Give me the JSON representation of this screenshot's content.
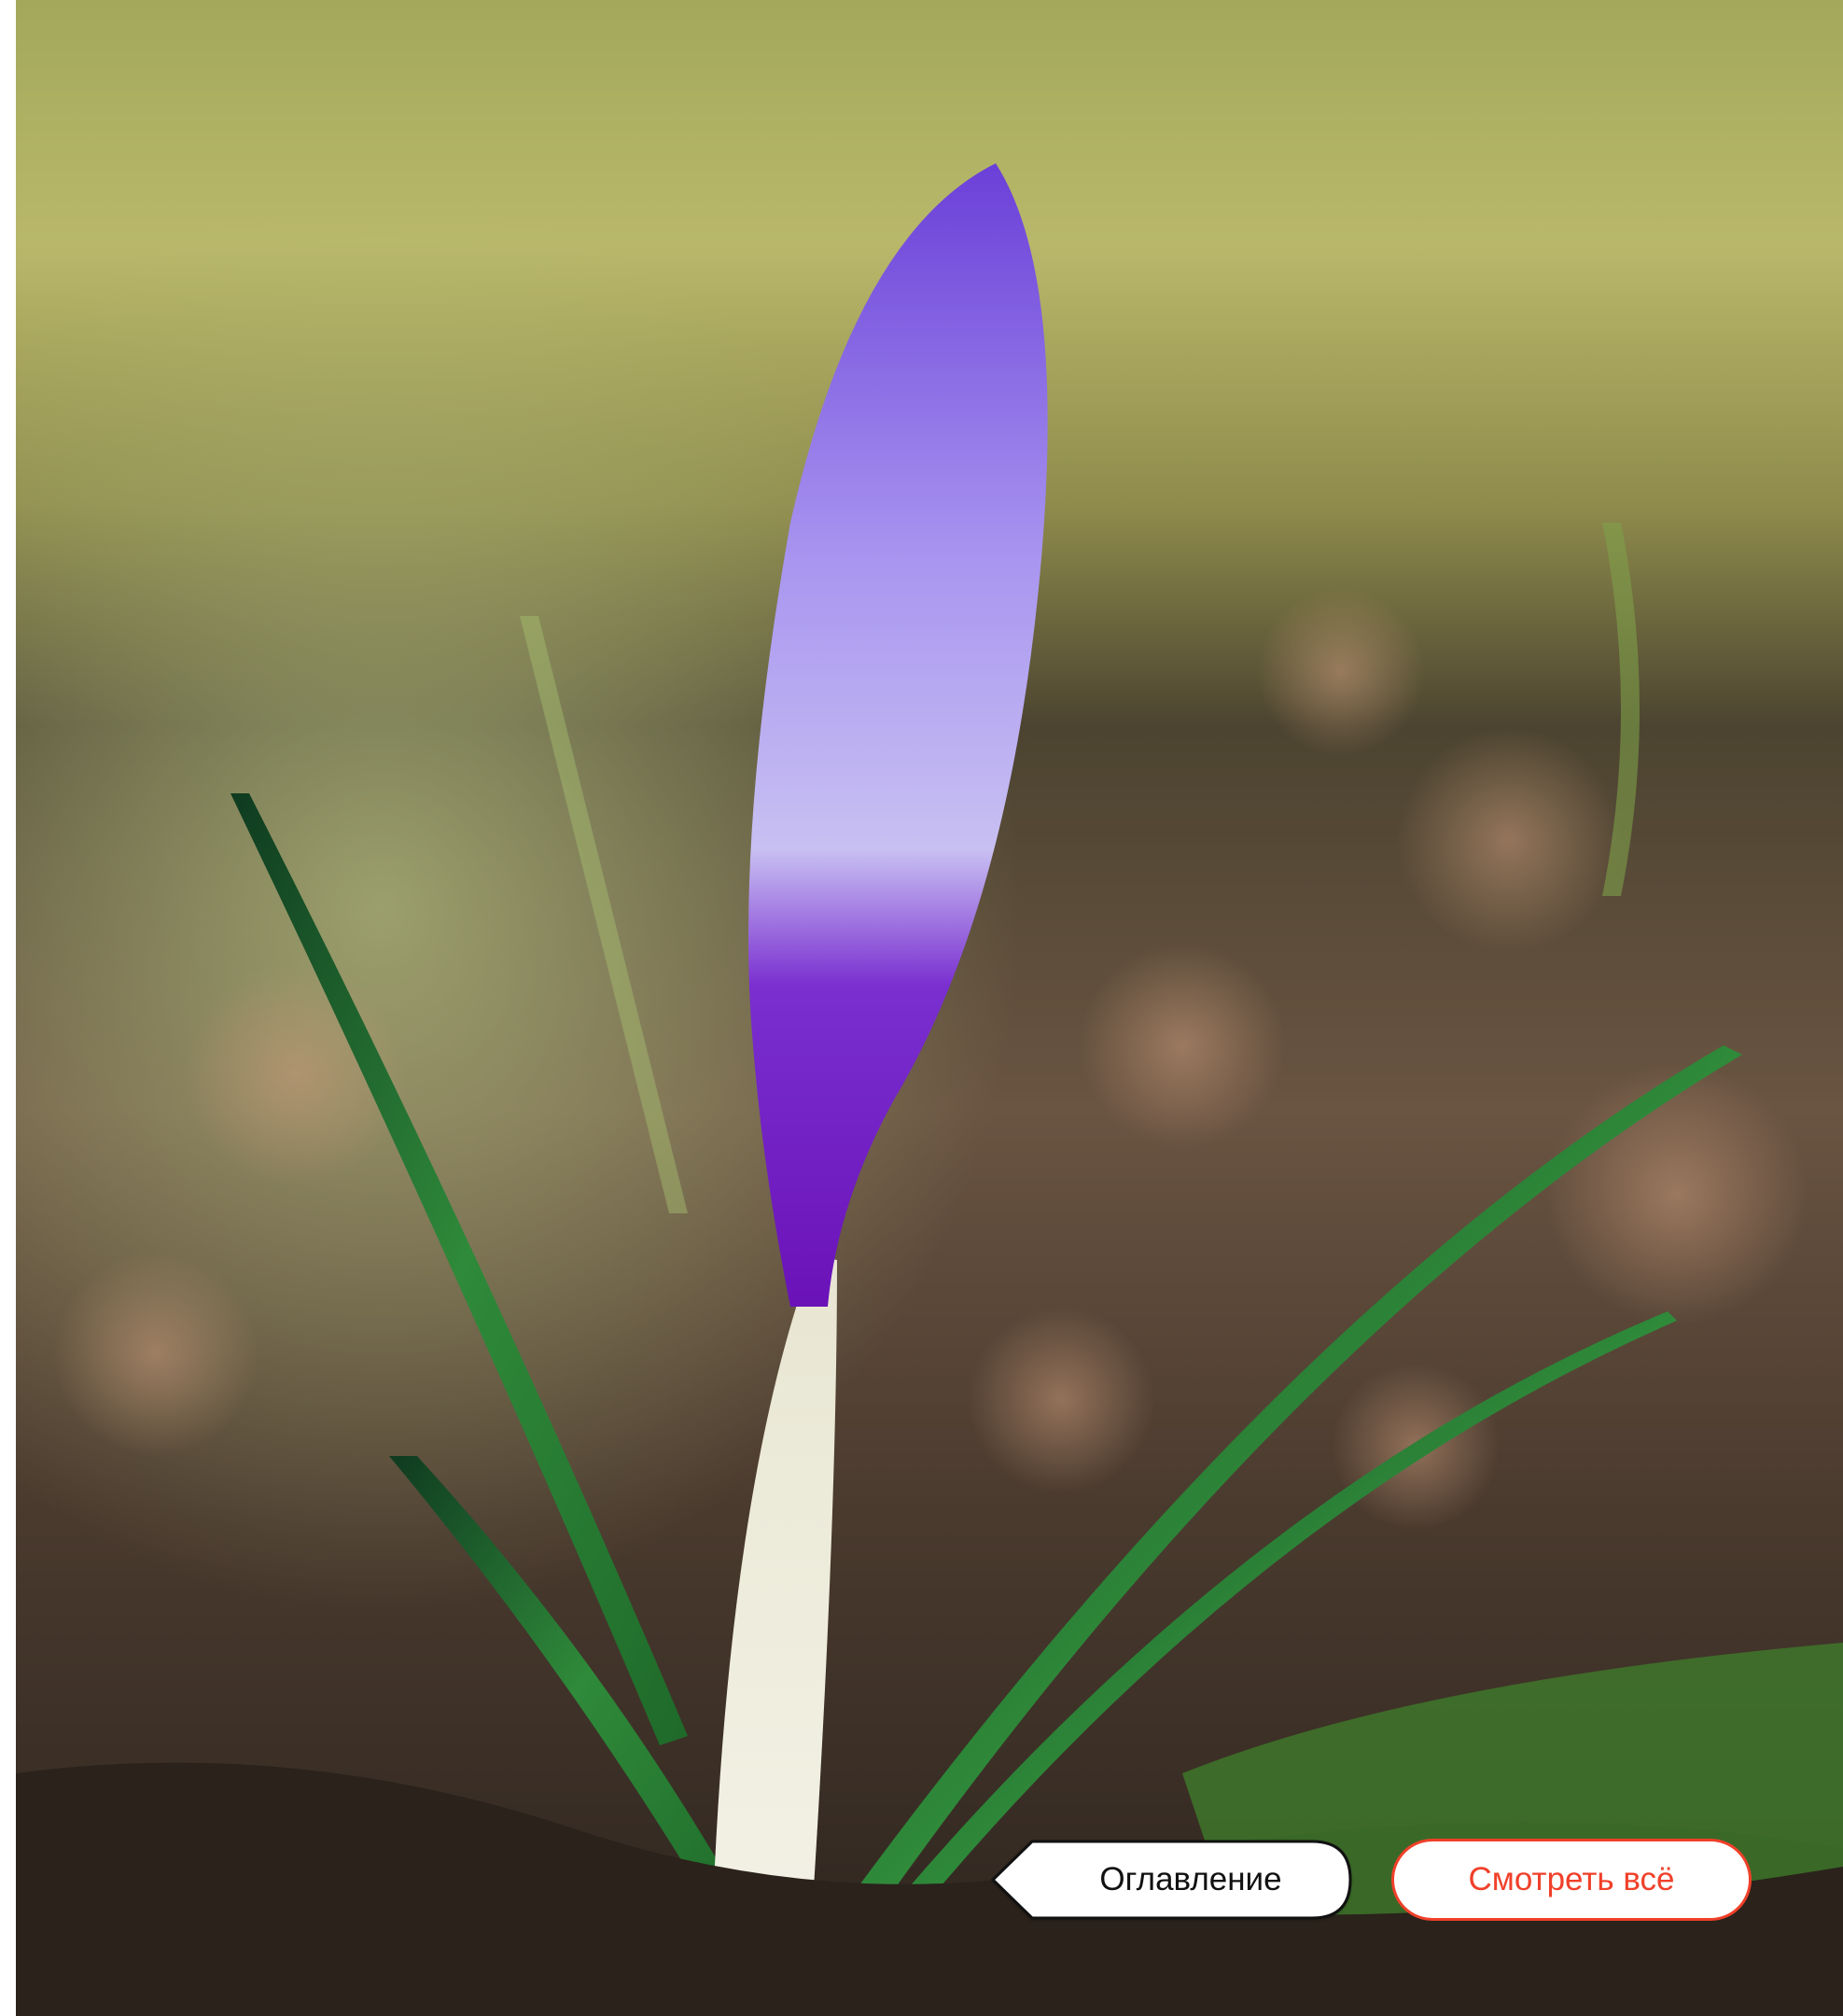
{
  "colors": {
    "accent": "#f0402a",
    "toc_fill": "#ffffff",
    "toc_border": "#111111"
  },
  "photo": {
    "subject": "crocus-bud-photo"
  },
  "nav": {
    "toc_label": "Оглавление",
    "view_all_label": "Смотреть всё"
  }
}
